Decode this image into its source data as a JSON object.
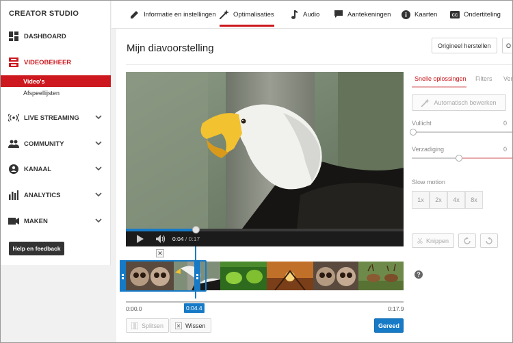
{
  "sidebar": {
    "brand": "CREATOR STUDIO",
    "items": [
      {
        "label": "DASHBOARD",
        "icon": "dashboard-icon"
      },
      {
        "label": "VIDEOBEHEER",
        "icon": "video-manager-icon"
      },
      {
        "label": "LIVE STREAMING",
        "icon": "live-icon"
      },
      {
        "label": "COMMUNITY",
        "icon": "people-icon"
      },
      {
        "label": "KANAAL",
        "icon": "account-icon"
      },
      {
        "label": "ANALYTICS",
        "icon": "bar-chart-icon"
      },
      {
        "label": "MAKEN",
        "icon": "camera-icon"
      }
    ],
    "subitems": [
      {
        "label": "Video's"
      },
      {
        "label": "Afspeellijsten"
      }
    ],
    "help": "Help en feedback"
  },
  "tabs": [
    {
      "label": "Informatie en instellingen",
      "icon": "pencil-icon"
    },
    {
      "label": "Optimalisaties",
      "icon": "magic-wand-icon"
    },
    {
      "label": "Audio",
      "icon": "music-note-icon"
    },
    {
      "label": "Aantekeningen",
      "icon": "comment-icon"
    },
    {
      "label": "Kaarten",
      "icon": "info-icon"
    },
    {
      "label": "Ondertiteling",
      "icon": "cc-icon"
    }
  ],
  "main": {
    "title": "Mijn diavoorstelling",
    "revert": "Origineel herstellen",
    "save_partial": "O"
  },
  "player": {
    "current": "0:04",
    "separator": " / ",
    "duration": "0:17",
    "progress": 0.25
  },
  "timeline": {
    "start": "0:00.0",
    "end": "0:17.9",
    "marker": "0:04.4",
    "close": "✕",
    "split": "Splitsen",
    "clear": "Wissen",
    "done": "Gereed"
  },
  "panel": {
    "tabs": [
      "Snelle oplossingen",
      "Filters",
      "Ver"
    ],
    "auto": "Automatisch bewerken",
    "fill_light": {
      "label": "Vullicht",
      "value": "0"
    },
    "saturation": {
      "label": "Verzadiging",
      "value": "0"
    },
    "slowmo_label": "Slow motion",
    "speeds": [
      "1x",
      "2x",
      "4x",
      "8x"
    ],
    "trim": "Knippen",
    "help": "?"
  },
  "colors": {
    "accent_red": "#cc181e",
    "accent_blue": "#167ac6"
  }
}
